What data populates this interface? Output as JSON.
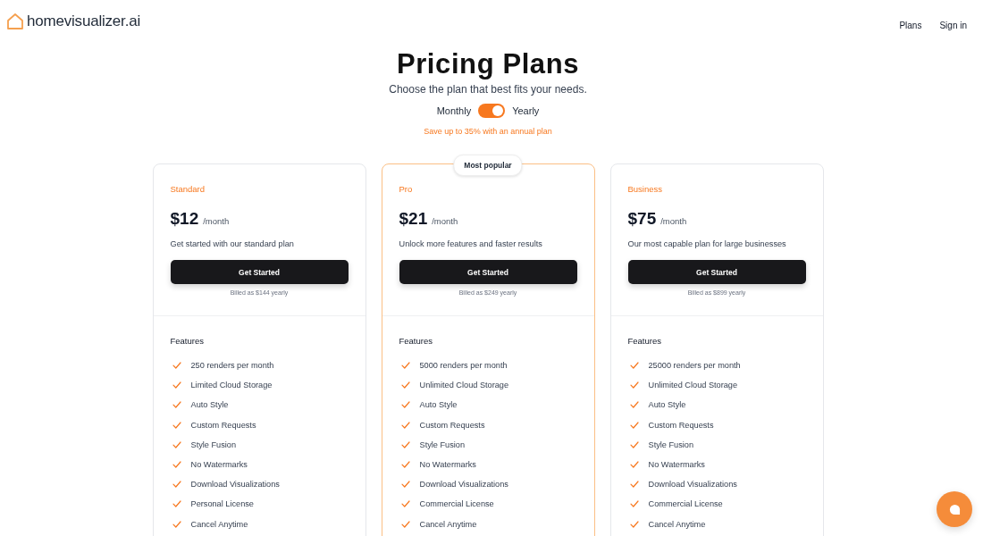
{
  "header": {
    "logo": "homevisualizer.ai",
    "nav": [
      "Plans",
      "Sign in"
    ]
  },
  "hero": {
    "title": "Pricing Plans",
    "subtitle": "Choose the plan that best fits your needs.",
    "billing_toggle": {
      "left_label": "Monthly",
      "right_label": "Yearly",
      "on": true
    },
    "note": "Save up to 35% with an annual plan"
  },
  "plans": [
    {
      "name": "Standard",
      "highlighted": false,
      "price": "$12",
      "period": "/month",
      "description": "Get started with our standard plan",
      "button": "Get Started",
      "billing_note": "Billed as $144 yearly",
      "features_heading": "Features",
      "features": [
        "250 renders per month",
        "Limited Cloud Storage",
        "Auto Style",
        "Custom Requests",
        "Style Fusion",
        "No Watermarks",
        "Download Visualizations",
        "Personal License",
        "Cancel Anytime"
      ]
    },
    {
      "name": "Pro",
      "highlighted": true,
      "badge": "Most popular",
      "price": "$21",
      "period": "/month",
      "description": "Unlock more features and faster results",
      "button": "Get Started",
      "billing_note": "Billed as $249 yearly",
      "features_heading": "Features",
      "features": [
        "5000 renders per month",
        "Unlimited Cloud Storage",
        "Auto Style",
        "Custom Requests",
        "Style Fusion",
        "No Watermarks",
        "Download Visualizations",
        "Commercial License",
        "Cancel Anytime"
      ]
    },
    {
      "name": "Business",
      "highlighted": false,
      "price": "$75",
      "period": "/month",
      "description": "Our most capable plan for large businesses",
      "button": "Get Started",
      "billing_note": "Billed as $899 yearly",
      "features_heading": "Features",
      "features": [
        "25000 renders per month",
        "Unlimited Cloud Storage",
        "Auto Style",
        "Custom Requests",
        "Style Fusion",
        "No Watermarks",
        "Download Visualizations",
        "Commercial License",
        "Cancel Anytime"
      ]
    }
  ]
}
